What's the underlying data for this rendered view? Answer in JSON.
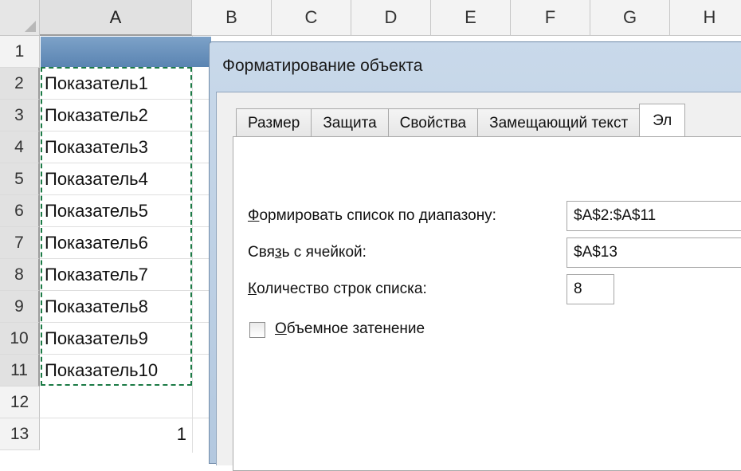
{
  "columns": [
    "A",
    "B",
    "C",
    "D",
    "E",
    "F",
    "G",
    "H"
  ],
  "rows": [
    "1",
    "2",
    "3",
    "4",
    "5",
    "6",
    "7",
    "8",
    "9",
    "10",
    "11",
    "12",
    "13"
  ],
  "cells_A": [
    "",
    "Показатель1",
    "Показатель2",
    "Показатель3",
    "Показатель4",
    "Показатель5",
    "Показатель6",
    "Показатель7",
    "Показатель8",
    "Показатель9",
    "Показатель10",
    "",
    "1"
  ],
  "dialog": {
    "title": "Форматирование объекта",
    "tabs": [
      "Размер",
      "Защита",
      "Свойства",
      "Замещающий текст",
      "Эл"
    ],
    "input_range_label_pre": "Ф",
    "input_range_label_rest": "ормировать список по диапазону:",
    "input_range_value": "$A$2:$A$11",
    "cell_link_label_pre": "Свя",
    "cell_link_label_u": "з",
    "cell_link_label_rest": "ь с ячейкой:",
    "cell_link_value": "$A$13",
    "rows_label_pre": "К",
    "rows_label_rest": "оличество строк списка:",
    "rows_value": "8",
    "shading_label_pre": "О",
    "shading_label_rest": "бъемное затенение",
    "shading_checked": false
  },
  "colors": {
    "copy_border": "#1b7a45",
    "titlebar": "#b3c8df"
  }
}
